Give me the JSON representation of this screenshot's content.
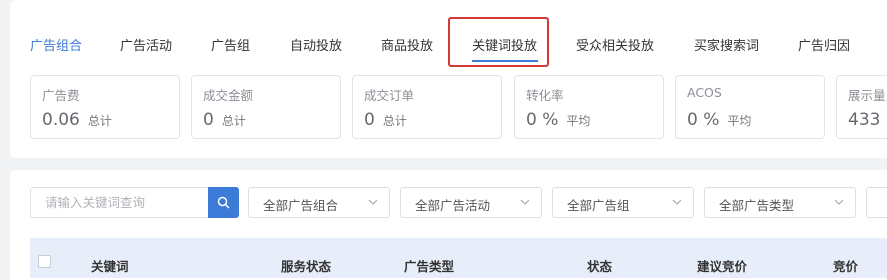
{
  "tabs": [
    {
      "label": "广告组合",
      "active": true
    },
    {
      "label": "广告活动"
    },
    {
      "label": "广告组"
    },
    {
      "label": "自动投放"
    },
    {
      "label": "商品投放"
    },
    {
      "label": "关键词投放",
      "highlighted": true
    },
    {
      "label": "受众相关投放"
    },
    {
      "label": "买家搜索词"
    },
    {
      "label": "广告归因"
    }
  ],
  "metrics": [
    {
      "label": "广告费",
      "value": "0.06",
      "unit": "总计"
    },
    {
      "label": "成交金额",
      "value": "0",
      "unit": "总计"
    },
    {
      "label": "成交订单",
      "value": "0",
      "unit": "总计"
    },
    {
      "label": "转化率",
      "value": "0 %",
      "unit": "平均"
    },
    {
      "label": "ACOS",
      "value": "0 %",
      "unit": "平均"
    },
    {
      "label": "展示量",
      "value": "433",
      "unit": ""
    }
  ],
  "search": {
    "placeholder": "请输入关键词查询"
  },
  "filters": [
    {
      "label": "全部广告组合"
    },
    {
      "label": "全部广告活动"
    },
    {
      "label": "全部广告组"
    },
    {
      "label": "全部广告类型"
    }
  ],
  "table": {
    "columns": [
      "关键词",
      "服务状态",
      "广告类型",
      "状态",
      "建议竞价",
      "竞价"
    ]
  },
  "colors": {
    "accent": "#3d7bd9",
    "highlight_border": "#d43a33",
    "header_bg": "#e8eef9"
  }
}
